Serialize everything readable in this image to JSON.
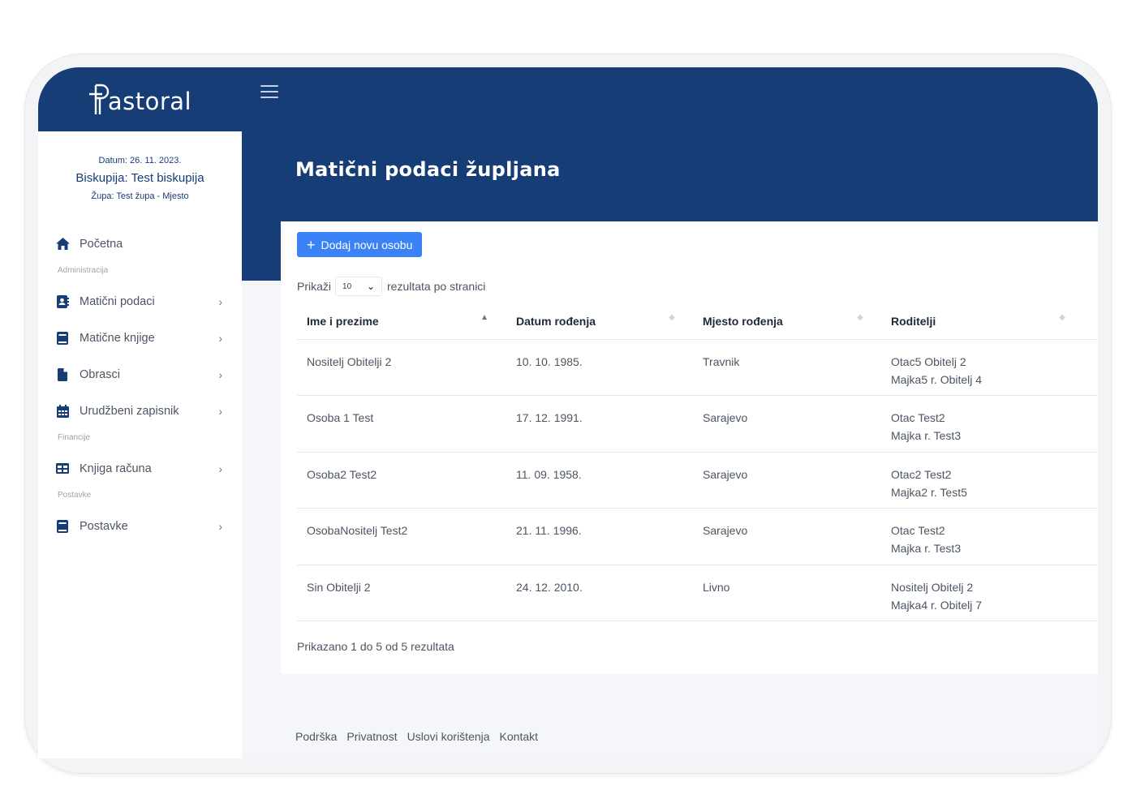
{
  "brand": {
    "name": "astoral"
  },
  "info": {
    "date": "Datum: 26. 11. 2023.",
    "biskupija": "Biskupija: Test biskupija",
    "zupa": "Župa: Test župa - Mjesto"
  },
  "nav": {
    "home": "Početna",
    "section_admin": "Administracija",
    "maticni_podaci": "Matični podaci",
    "maticne_knjige": "Matične knjige",
    "obrasci": "Obrasci",
    "urudzbeni": "Urudžbeni zapisnik",
    "section_financije": "Financije",
    "knjiga_racuna": "Knjiga računa",
    "section_postavke": "Postavke",
    "postavke": "Postavke"
  },
  "page": {
    "title": "Matični podaci župljana"
  },
  "toolbar": {
    "add_label": "Dodaj novu osobu"
  },
  "pagination": {
    "show_label": "Prikaži",
    "per_page": "10",
    "suffix": "rezultata po stranici"
  },
  "table": {
    "headers": [
      "Ime i prezime",
      "Datum rođenja",
      "Mjesto rođenja",
      "Roditelji"
    ],
    "rows": [
      {
        "name": "Nositelj Obitelji 2",
        "dob": "10. 10. 1985.",
        "place": "Travnik",
        "parent1": "Otac5 Obitelj 2",
        "parent2": "Majka5 r. Obitelj 4"
      },
      {
        "name": "Osoba 1 Test",
        "dob": "17. 12. 1991.",
        "place": "Sarajevo",
        "parent1": "Otac Test2",
        "parent2": "Majka r. Test3"
      },
      {
        "name": "Osoba2 Test2",
        "dob": "11. 09. 1958.",
        "place": "Sarajevo",
        "parent1": "Otac2 Test2",
        "parent2": "Majka2 r. Test5"
      },
      {
        "name": "OsobaNositelj Test2",
        "dob": "21. 11. 1996.",
        "place": "Sarajevo",
        "parent1": "Otac Test2",
        "parent2": "Majka r. Test3"
      },
      {
        "name": "Sin Obitelji 2",
        "dob": "24. 12. 2010.",
        "place": "Livno",
        "parent1": "Nositelj Obitelj 2",
        "parent2": "Majka4 r. Obitelj 7"
      }
    ]
  },
  "summary": "Prikazano 1 do 5 od 5 rezultata",
  "footer": {
    "support": "Podrška",
    "privacy": "Privatnost",
    "terms": "Uslovi korištenja",
    "contact": "Kontakt"
  },
  "colors": {
    "primary": "#173d77",
    "accent": "#3b82f6"
  }
}
